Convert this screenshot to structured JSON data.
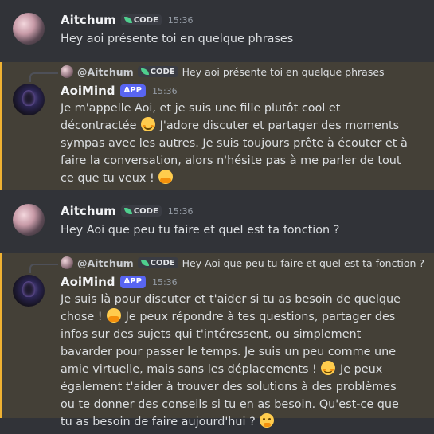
{
  "messages": [
    {
      "username": "Aitchum",
      "tag": "CODE",
      "time": "15:36",
      "text": "Hey aoi présente toi en quelque phrases"
    },
    {
      "reply": {
        "name": "@Aitchum",
        "tag": "CODE",
        "text": "Hey aoi présente toi en quelque phrases"
      },
      "username": "AoiMind",
      "tag": "APP",
      "time": "15:36",
      "text_parts": [
        "Je m'appelle Aoi, et je suis une fille plutôt cool et décontractée ",
        " J'adore discuter et partager des moments sympas avec les autres. Je suis toujours prête à écouter et à faire la conversation, alors n'hésite pas à me parler de tout ce que tu veux ! "
      ],
      "emojis": [
        "smiling-face-with-smiling-eyes",
        "hugging-face"
      ]
    },
    {
      "username": "Aitchum",
      "tag": "CODE",
      "time": "15:36",
      "text": "Hey Aoi que peu tu faire et quel est ta fonction ?"
    },
    {
      "reply": {
        "name": "@Aitchum",
        "tag": "CODE",
        "text": "Hey Aoi que peu tu faire et quel est ta fonction ?"
      },
      "username": "AoiMind",
      "tag": "APP",
      "time": "15:36",
      "text_parts": [
        "Je suis là pour discuter et t'aider si tu as besoin de quelque chose ! ",
        " Je peux répondre à tes questions, partager des infos sur des sujets qui t'intéressent, ou simplement bavarder pour passer le temps. Je suis un peu comme une amie virtuelle, mais sans les déplacements ! ",
        " Je peux également t'aider à trouver des solutions à des problèmes ou te donner des conseils si tu en as besoin. Qu'est-ce que tu as besoin de faire aujourd'hui ? "
      ],
      "emojis": [
        "hugging-face",
        "smiling-face-with-smiling-eyes",
        "thinking-face"
      ]
    }
  ],
  "colors": {
    "background": "#313338",
    "mention_highlight": "#444037",
    "mention_bar": "#f0b232",
    "app_badge": "#5865f2",
    "code_leaf": "#4fcf8e"
  }
}
